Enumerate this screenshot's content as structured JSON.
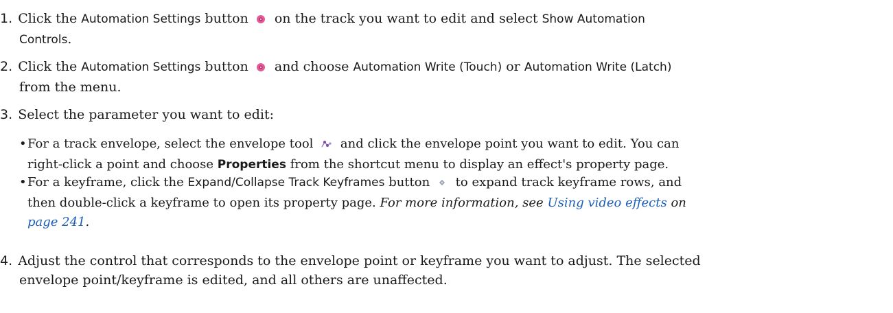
{
  "steps": [
    {
      "number": "1.",
      "t1": "Click the ",
      "ui1": "Automation Settings",
      "t2": " button ",
      "icon": "gear-icon",
      "t3": " on the track you want to edit and select ",
      "ui2": "Show Automation",
      "ui3": "Controls",
      "t4": "."
    },
    {
      "number": "2.",
      "t1": "Click the ",
      "ui1": "Automation Settings",
      "t2": " button ",
      "icon": "gear-icon",
      "t3": " and choose ",
      "ui2": "Automation Write (Touch)",
      "t4": " or ",
      "ui3": "Automation Write (Latch)",
      "t5": "from the menu."
    },
    {
      "number": "3.",
      "text": "Select the parameter you want to edit:"
    },
    {
      "number": "4.",
      "line1": "Adjust the control that corresponds to the envelope point or keyframe you want to adjust. The selected",
      "line2": "envelope point/keyframe is edited, and all others are unaffected."
    }
  ],
  "bullets": [
    {
      "t1": "For a track envelope, select the envelope tool ",
      "icon": "envelope-tool-icon",
      "t2": " and click the envelope point you want to edit. You can",
      "t3": "right-click a point and choose ",
      "bold": "Properties",
      "t4": " from the shortcut menu to display an effect's property page."
    },
    {
      "t1": "For a keyframe, click the ",
      "ui": "Expand/Collapse Track Keyframes",
      "t2": " button ",
      "icon": "expand-keyframes-icon",
      "t3": " to expand track keyframe rows, and",
      "t4": "then double-click a keyframe to open its property page. ",
      "ital1": "For more information, see ",
      "link1": "Using video effects",
      "ital2": " on",
      "link2": "page 241",
      "ital3": "."
    }
  ],
  "colors": {
    "text": "#1a1a1a",
    "link": "#1d5fb8",
    "gear_icon": "#d9478c",
    "envelope_icon": "#8a4fb0",
    "keyframe_icon": "#7f8a99"
  }
}
